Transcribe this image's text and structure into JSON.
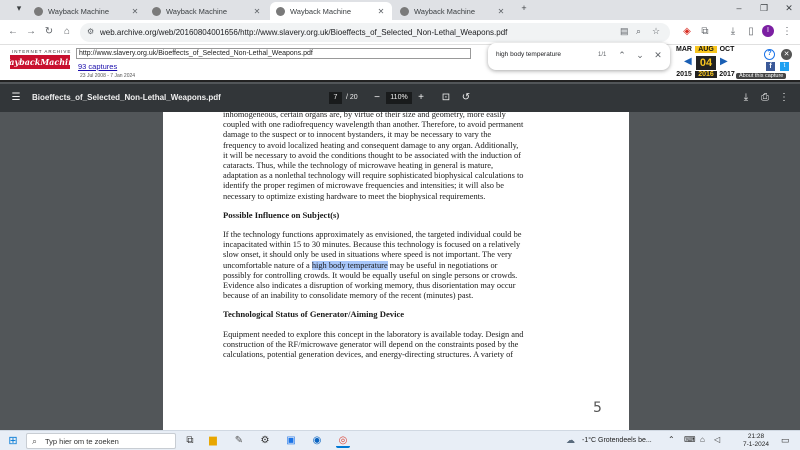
{
  "browser": {
    "tabs": [
      {
        "title": "Wayback Machine",
        "active": false
      },
      {
        "title": "Wayback Machine",
        "active": false
      },
      {
        "title": "Wayback Machine",
        "active": true
      },
      {
        "title": "Wayback Machine",
        "active": false
      }
    ],
    "new_tab": "+",
    "address": "web.archive.org/web/20160804001656/http://www.slavery.org.uk/Bioeffects_of_Selected_Non-Lethal_Weapons.pdf"
  },
  "wayback": {
    "logo_top": "INTERNET ARCHIVE",
    "logo": "WaybackMachine",
    "url": "http://www.slavery.org.uk/Bioeffects_of_Selected_Non-Lethal_Weapons.pdf",
    "captures": "93 captures",
    "range": "23 Jul 2008 - 7 Jan 2024",
    "months": [
      "MAR",
      "AUG",
      "OCT"
    ],
    "day": "04",
    "years": [
      "2015",
      "2016",
      "2017"
    ],
    "about": "About this capture"
  },
  "find": {
    "query": "high body temperature",
    "count": "1/1"
  },
  "pdf": {
    "title": "Bioeffects_of_Selected_Non-Lethal_Weapons.pdf",
    "page": "7",
    "total": "/ 20",
    "zoom": "110%"
  },
  "doc": {
    "p1": [
      "inhomogeneous, certain organs are, by virtue of their size and geometry, more easily",
      "coupled with one radiofrequency wavelength than another. Therefore, to avoid permanent",
      "damage to the suspect or to innocent bystanders, it may be necessary to vary the",
      "frequency to avoid localized heating and consequent damage to any organ. Additionally,",
      "it will be necessary to avoid the conditions thought to be associated with the induction of",
      "cataracts. Thus, while the technology of microwave heating in general is mature,",
      "adaptation as a nonlethal technology will require sophisticated biophysical calculations to",
      "identify the proper regimen of microwave frequencies and intensities; it will also be",
      "necessary to optimize existing hardware to meet the biophysical requirements."
    ],
    "h1": "Possible Influence on Subject(s)",
    "p2a": [
      "If the technology functions approximately as envisioned, the targeted individual could be",
      "incapacitated within 15 to 30 minutes. Because this technology is focused on a relatively",
      "slow onset, it should only be used in situations where speed is not important. The very"
    ],
    "p2_pre": "uncomfortable nature of a ",
    "p2_hl": "high body temperature",
    "p2_post": " may be useful in negotiations or",
    "p2b": [
      "possibly for controlling crowds. It would be equally useful on single persons or crowds.",
      "Evidence also indicates a disruption of working memory, thus disorientation may occur",
      "because of an inability to consolidate memory of the recent (minutes) past."
    ],
    "h2": "Technological Status of Generator/Aiming Device",
    "p3": [
      "Equipment needed to explore this concept in the laboratory is available today. Design and",
      "construction of the RF/microwave generator will depend on the constraints posed by the",
      "calculations, potential generation devices, and energy-directing structures. A variety of"
    ],
    "page_number": "5"
  },
  "taskbar": {
    "search_placeholder": "Typ hier om te zoeken",
    "weather": "-1°C  Grotendeels be...",
    "time": "21:28",
    "date": "7-1-2024"
  }
}
